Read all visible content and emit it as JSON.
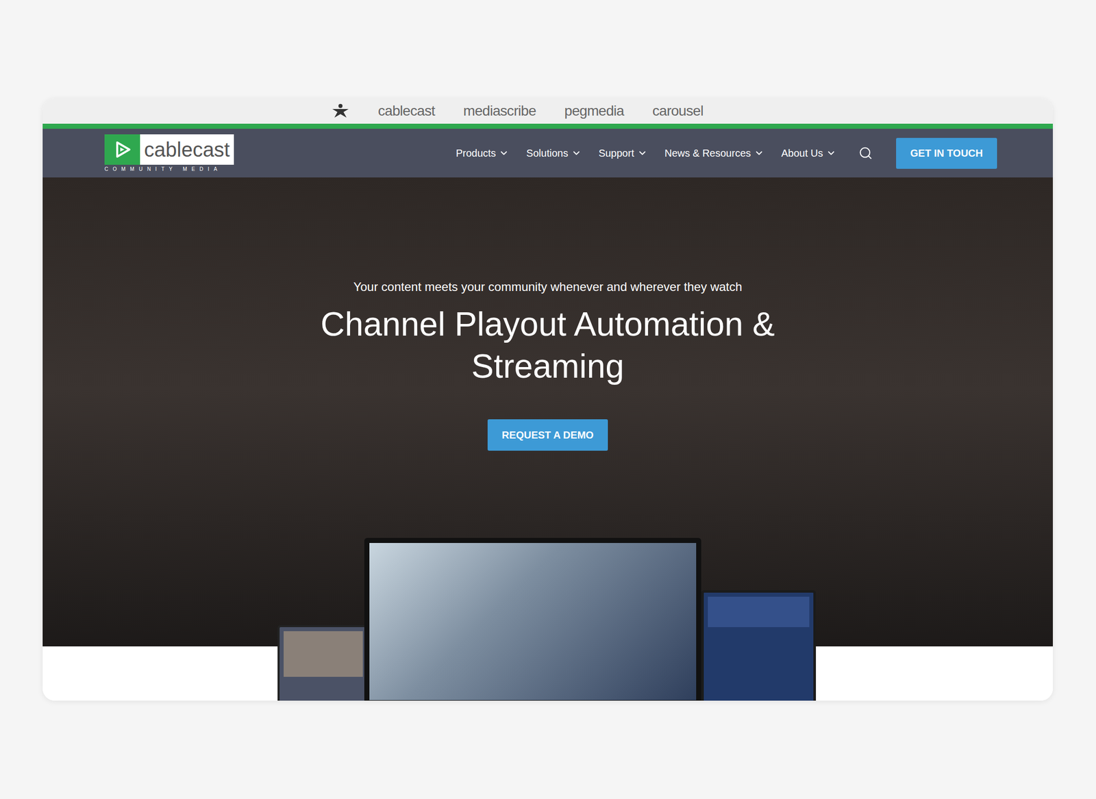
{
  "brand_bar": {
    "items": [
      "cablecast",
      "mediascribe",
      "pegmedia",
      "carousel"
    ]
  },
  "header": {
    "logo": {
      "name": "cablecast",
      "tagline": "COMMUNITY MEDIA"
    },
    "nav": [
      {
        "label": "Products"
      },
      {
        "label": "Solutions"
      },
      {
        "label": "Support"
      },
      {
        "label": "News & Resources"
      },
      {
        "label": "About Us"
      }
    ],
    "cta": "GET IN TOUCH"
  },
  "hero": {
    "subtitle": "Your content meets your community whenever and wherever they watch",
    "title": "Channel Playout Automation & Streaming",
    "button": "REQUEST A DEMO"
  }
}
